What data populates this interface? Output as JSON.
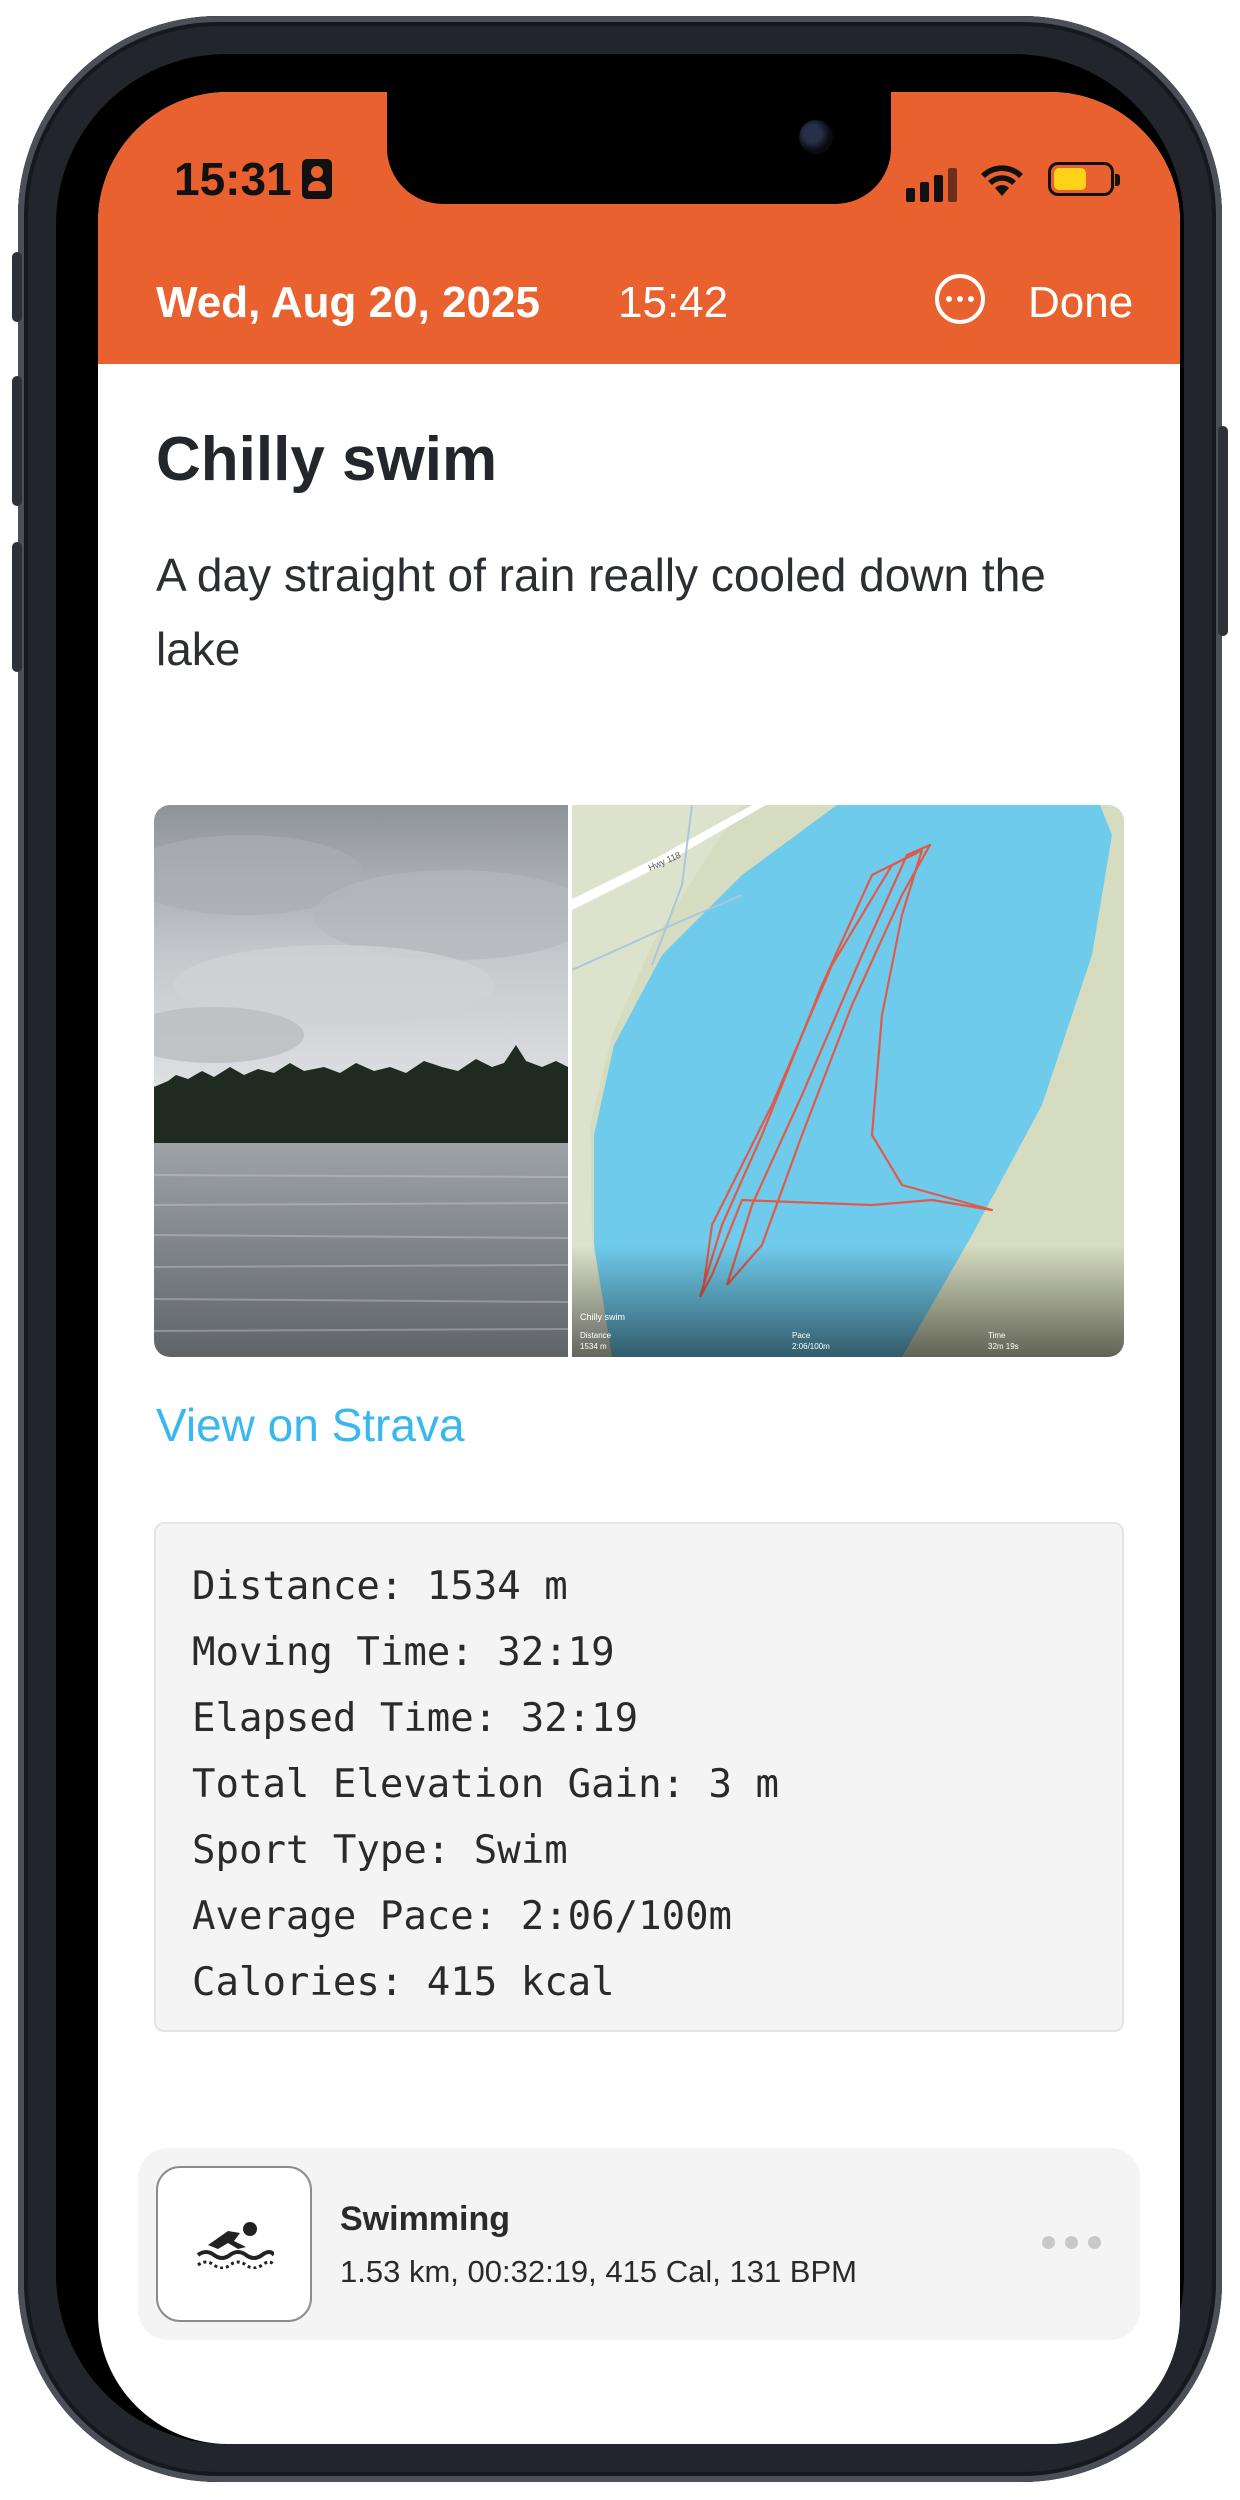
{
  "status_bar": {
    "time": "15:31",
    "battery_level": 0.6,
    "battery_color": "#ffd21a"
  },
  "header": {
    "date": "Wed, Aug 20, 2025",
    "time": "15:42",
    "more_icon": "ellipsis-circle-icon",
    "done_label": "Done",
    "bg_color": "#e8612e"
  },
  "entry": {
    "title": "Chilly swim",
    "description": "A day straight of rain really cooled down the lake"
  },
  "map_overlay": {
    "activity_name": "Chilly swim",
    "distance_label": "Distance",
    "distance_value": "1534 m",
    "pace_label": "Pace",
    "pace_value": "2:06/100m",
    "time_label": "Time",
    "time_value": "32m 19s",
    "road_label": "Hwy 118"
  },
  "strava_link": {
    "label": "View on Strava",
    "color": "#39b8ef"
  },
  "stats": [
    "Distance: 1534 m",
    "Moving Time: 32:19",
    "Elapsed Time: 32:19",
    "Total Elevation Gain: 3 m",
    "Sport Type: Swim",
    "Average Pace: 2:06/100m",
    "Calories: 415 kcal"
  ],
  "workout": {
    "icon": "swimmer-icon",
    "name": "Swimming",
    "summary": "1.53 km, 00:32:19, 415 Cal, 131 BPM"
  }
}
